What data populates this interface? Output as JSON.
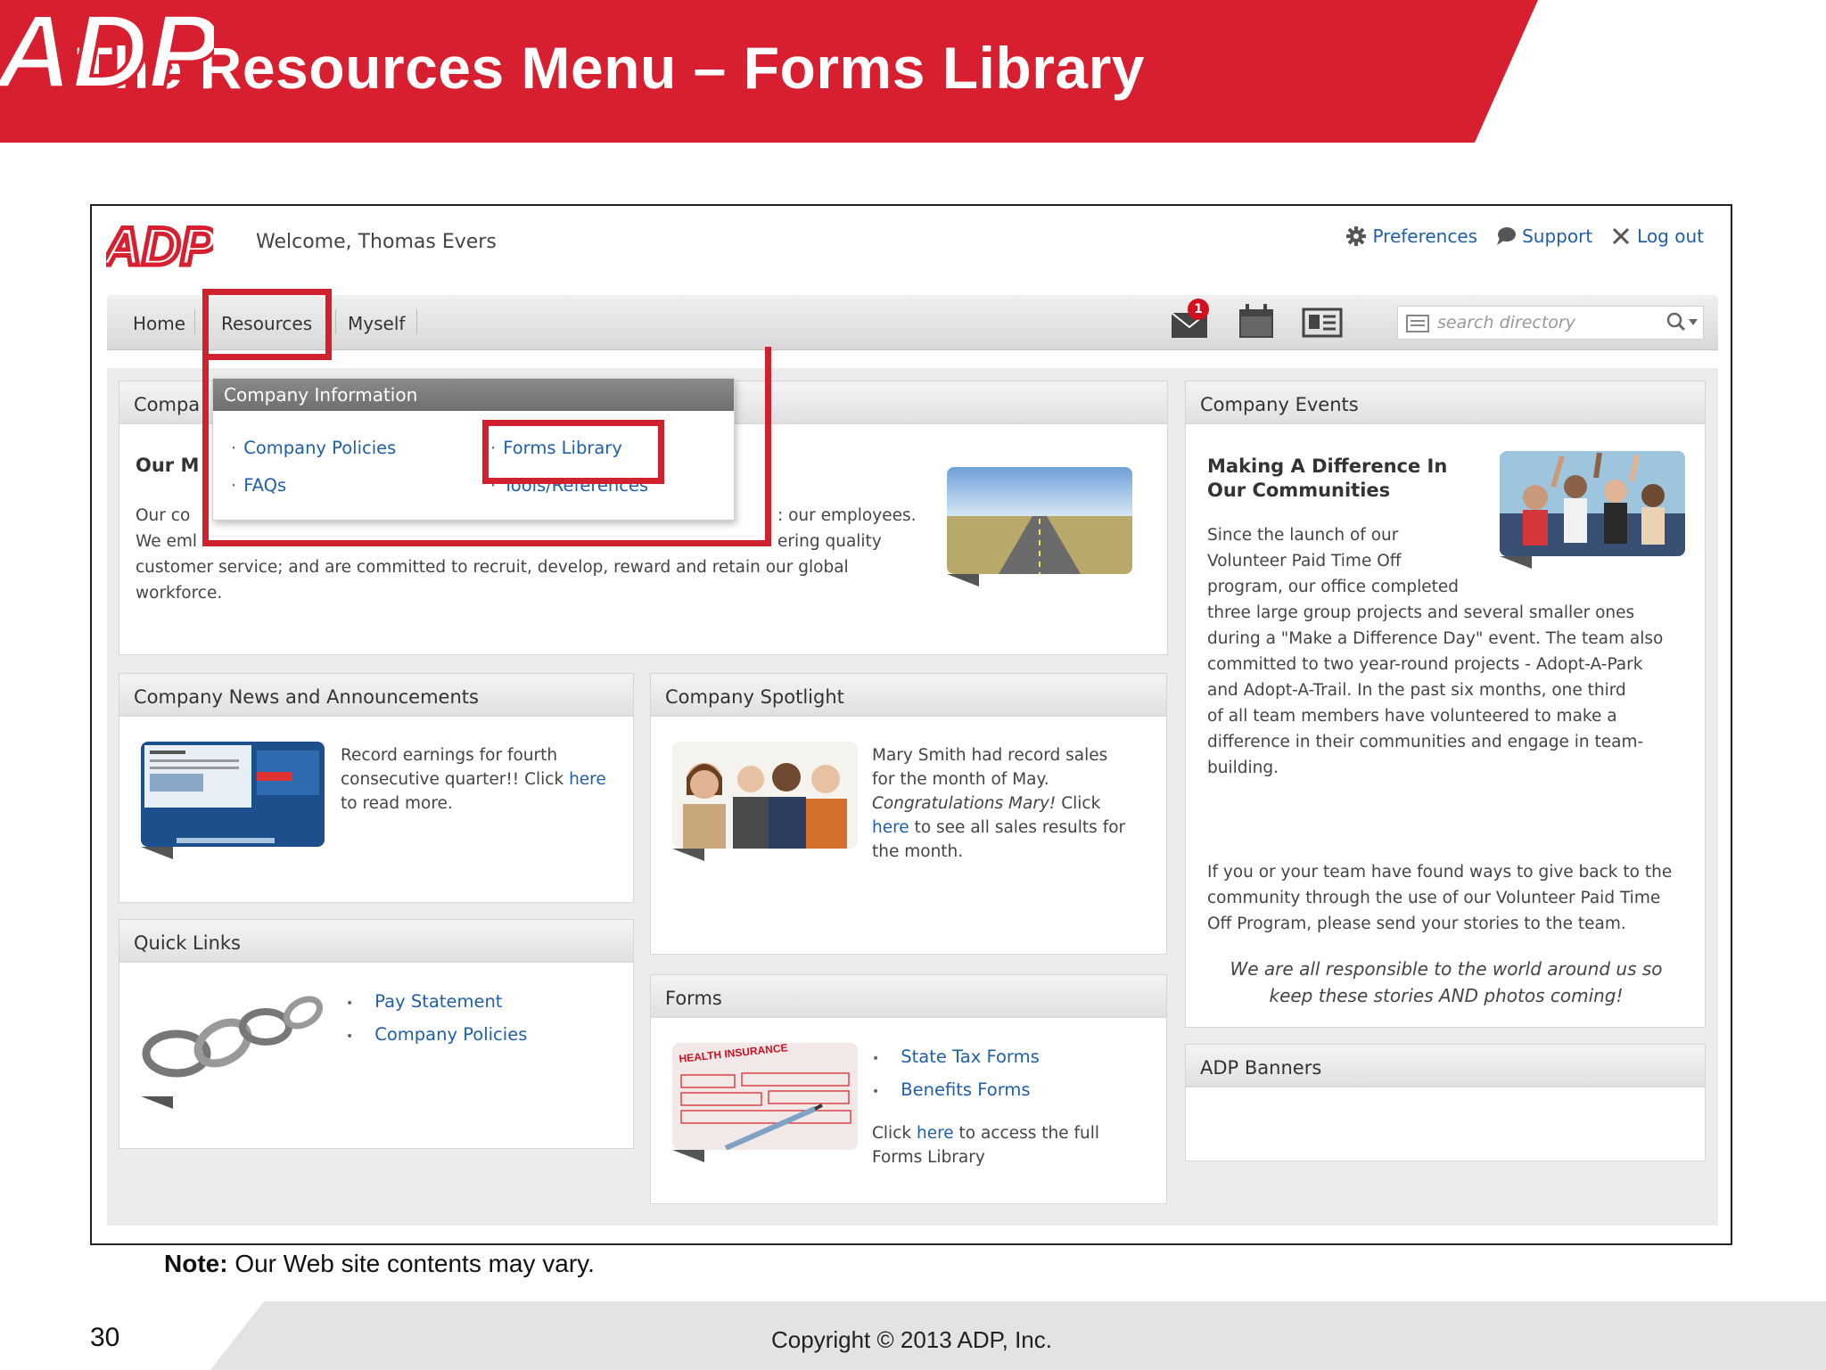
{
  "slide": {
    "title": "The Resources Menu – Forms Library",
    "logo_text": "ADP",
    "note_label": "Note:",
    "note_text": "Our Web site contents may vary.",
    "page_number": "30",
    "copyright": "Copyright © 2013 ADP, Inc.",
    "colors": {
      "brand_red": "#d71f30",
      "footer_gray": "#e3e3e3"
    }
  },
  "app": {
    "logo_text": "ADP",
    "welcome": "Welcome, Thomas Evers",
    "top_links": [
      {
        "label": "Preferences",
        "icon": "gear-icon"
      },
      {
        "label": "Support",
        "icon": "speech-bubble-icon"
      },
      {
        "label": "Log out",
        "icon": "close-icon"
      }
    ],
    "nav": {
      "items": [
        "Home",
        "Resources",
        "Myself"
      ],
      "notification_count": "1",
      "icons": [
        "mail-icon",
        "calendar-icon",
        "contact-card-icon"
      ],
      "search_placeholder": "search directory"
    },
    "dropdown": {
      "header": "Company Information",
      "col1": [
        "Company Policies",
        "FAQs"
      ],
      "col2": [
        "Forms Library",
        "Tools/References"
      ]
    },
    "panels": {
      "about": {
        "head": "Compa",
        "title": "Our M",
        "line1_left": "Our co",
        "line1_right": ": our employees.",
        "line2_left": "We eml",
        "line2_right": "ering quality",
        "line3": "customer service; and are committed to recruit, develop, reward and retain our global",
        "line4": "workforce."
      },
      "events": {
        "head": "Company Events",
        "title_line1": "Making A Difference In",
        "title_line2": "Our Communities",
        "p1_lines": [
          "Since the launch of our",
          "Volunteer Paid Time Off",
          "program, our office completed",
          "three large group projects and several smaller ones",
          "during a \"Make a Difference Day\" event.  The team also",
          "committed to two year-round projects - Adopt-A-Park",
          "and Adopt-A-Trail.  In the past six months, one third",
          "of all team members have volunteered to make a",
          "difference in their communities and engage in team-",
          "building."
        ],
        "p2_lines": [
          "If you or your team have found ways to give back to the",
          "community through the use of our Volunteer Paid Time",
          "Off Program, please send your stories to the team."
        ],
        "p3_lines": [
          "We are all responsible to the world around us so",
          "keep these stories AND photos coming!"
        ]
      },
      "news": {
        "head": "Company News and Announcements",
        "text1": "Record earnings for fourth",
        "text2": "consecutive quarter!! Click ",
        "link": "here",
        "text3": "to read more."
      },
      "spotlight": {
        "head": "Company Spotlight",
        "text1": "Mary Smith had record sales",
        "text2": "for the month of May.",
        "text3_italic": "Congratulations Mary!",
        "text3_rest": " Click",
        "link": "here",
        "text4_rest": " to see all sales results for",
        "text5": "the month."
      },
      "quicklinks": {
        "head": "Quick Links",
        "links": [
          "Pay Statement",
          "Company Policies"
        ]
      },
      "forms": {
        "head": "Forms",
        "links": [
          "State Tax Forms",
          "Benefits Forms"
        ],
        "text1": "Click ",
        "link": "here",
        "text2": " to access the full",
        "text3": "Forms Library"
      },
      "banners": {
        "head": "ADP Banners"
      }
    }
  }
}
